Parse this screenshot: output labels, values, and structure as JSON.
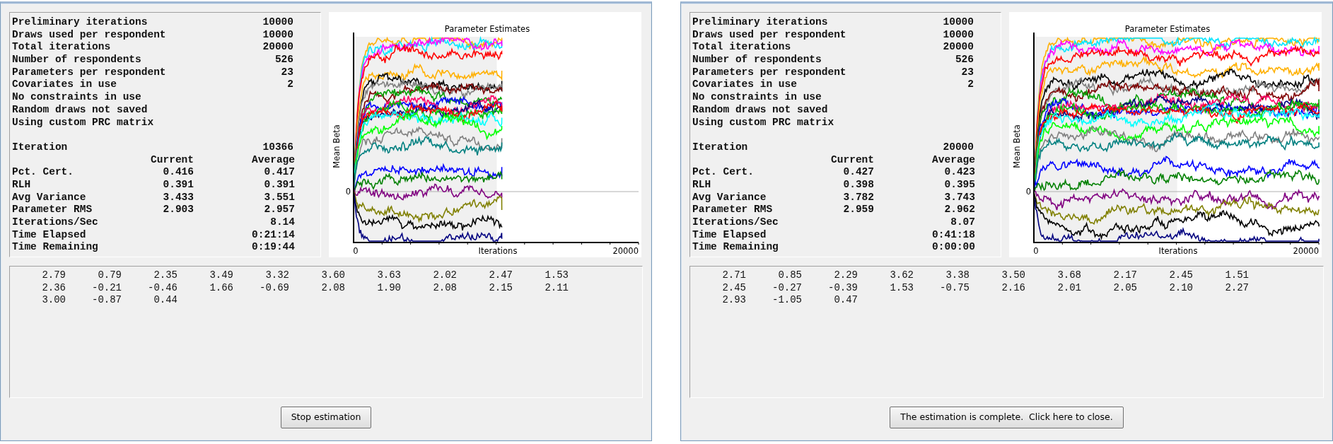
{
  "windows": [
    {
      "summary": [
        {
          "label": "Preliminary iterations",
          "value": "10000"
        },
        {
          "label": "Draws used per respondent",
          "value": "10000"
        },
        {
          "label": "Total iterations",
          "value": "20000"
        },
        {
          "label": "Number of respondents",
          "value": "526"
        },
        {
          "label": "Parameters per respondent",
          "value": "23"
        },
        {
          "label": "Covariates in use",
          "value": "2"
        },
        {
          "label": "No constraints in use"
        },
        {
          "label": "Random draws not saved"
        },
        {
          "label": "Using custom PRC matrix"
        }
      ],
      "iteration": {
        "label": "Iteration",
        "value": "10366"
      },
      "columns": [
        "Current",
        "Average"
      ],
      "stats": [
        {
          "label": "Pct. Cert.",
          "current": "0.416",
          "average": "0.417"
        },
        {
          "label": "RLH",
          "current": "0.391",
          "average": "0.391"
        },
        {
          "label": "Avg Variance",
          "current": "3.433",
          "average": "3.551"
        },
        {
          "label": "Parameter RMS",
          "current": "2.903",
          "average": "2.957"
        },
        {
          "label": "Iterations/Sec",
          "average": "8.14"
        },
        {
          "label": "Time Elapsed",
          "average": "0:21:14"
        },
        {
          "label": "Time Remaining",
          "average": "0:19:44"
        }
      ],
      "chart": {
        "title": "Parameter Estimates",
        "ylabel": "Mean Beta",
        "y_tick": "0",
        "x_start": "0",
        "xlabel": "Iterations",
        "x_end": "20000",
        "level": 0.52
      },
      "estimates": [
        [
          "2.79",
          "0.79",
          "2.35",
          "3.49",
          "3.32",
          "3.60",
          "3.63",
          "2.02",
          "2.47",
          "1.53"
        ],
        [
          "2.36",
          "-0.21",
          "-0.46",
          "1.66",
          "-0.69",
          "2.08",
          "1.90",
          "2.08",
          "2.15",
          "2.11"
        ],
        [
          "3.00",
          "-0.87",
          "0.44"
        ]
      ],
      "button": "Stop estimation"
    },
    {
      "summary": [
        {
          "label": "Preliminary iterations",
          "value": "10000"
        },
        {
          "label": "Draws used per respondent",
          "value": "10000"
        },
        {
          "label": "Total iterations",
          "value": "20000"
        },
        {
          "label": "Number of respondents",
          "value": "526"
        },
        {
          "label": "Parameters per respondent",
          "value": "23"
        },
        {
          "label": "Covariates in use",
          "value": "2"
        },
        {
          "label": "No constraints in use"
        },
        {
          "label": "Random draws not saved"
        },
        {
          "label": "Using custom PRC matrix"
        }
      ],
      "iteration": {
        "label": "Iteration",
        "value": "20000"
      },
      "columns": [
        "Current",
        "Average"
      ],
      "stats": [
        {
          "label": "Pct. Cert.",
          "current": "0.427",
          "average": "0.423"
        },
        {
          "label": "RLH",
          "current": "0.398",
          "average": "0.395"
        },
        {
          "label": "Avg Variance",
          "current": "3.782",
          "average": "3.743"
        },
        {
          "label": "Parameter RMS",
          "current": "2.959",
          "average": "2.962"
        },
        {
          "label": "Iterations/Sec",
          "average": "8.07"
        },
        {
          "label": "Time Elapsed",
          "average": "0:41:18"
        },
        {
          "label": "Time Remaining",
          "average": "0:00:00"
        }
      ],
      "chart": {
        "title": "Parameter Estimates",
        "ylabel": "Mean Beta",
        "y_tick": "0",
        "x_start": "0",
        "xlabel": "Iterations",
        "x_end": "20000",
        "level": 1.0
      },
      "estimates": [
        [
          "2.71",
          "0.85",
          "2.29",
          "3.62",
          "3.38",
          "3.50",
          "3.68",
          "2.17",
          "2.45",
          "1.51"
        ],
        [
          "2.45",
          "-0.27",
          "-0.39",
          "1.53",
          "-0.75",
          "2.16",
          "2.01",
          "2.05",
          "2.10",
          "2.27"
        ],
        [
          "2.93",
          "-1.05",
          "0.47"
        ]
      ],
      "button": "The estimation is complete.  Click here to close."
    }
  ]
}
